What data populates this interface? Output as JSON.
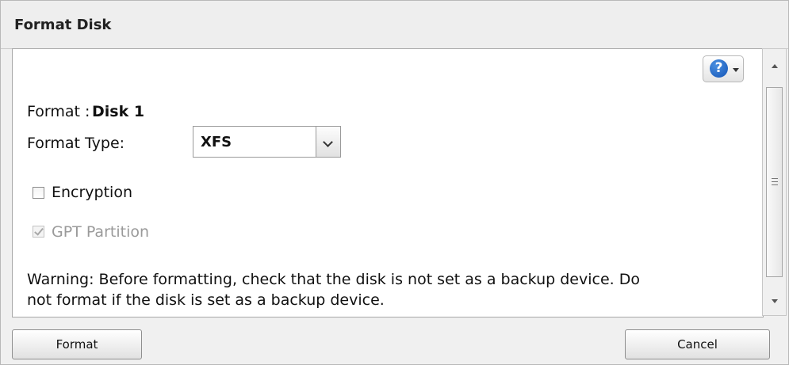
{
  "dialog": {
    "title": "Format Disk"
  },
  "help": {
    "glyph": "?",
    "icon": "help-icon"
  },
  "format": {
    "label": "Format :",
    "disk": "Disk 1"
  },
  "format_type": {
    "label": "Format Type:",
    "value": "XFS"
  },
  "encryption": {
    "label": "Encryption",
    "checked": false
  },
  "gpt_partition": {
    "label": "GPT Partition",
    "checked": true,
    "disabled": true
  },
  "warning": {
    "line1": "Warning: Before formatting, check that the disk is not set as a backup device. Do",
    "line2": "not format if the disk is set as a backup device."
  },
  "buttons": {
    "format": "Format",
    "cancel": "Cancel"
  }
}
